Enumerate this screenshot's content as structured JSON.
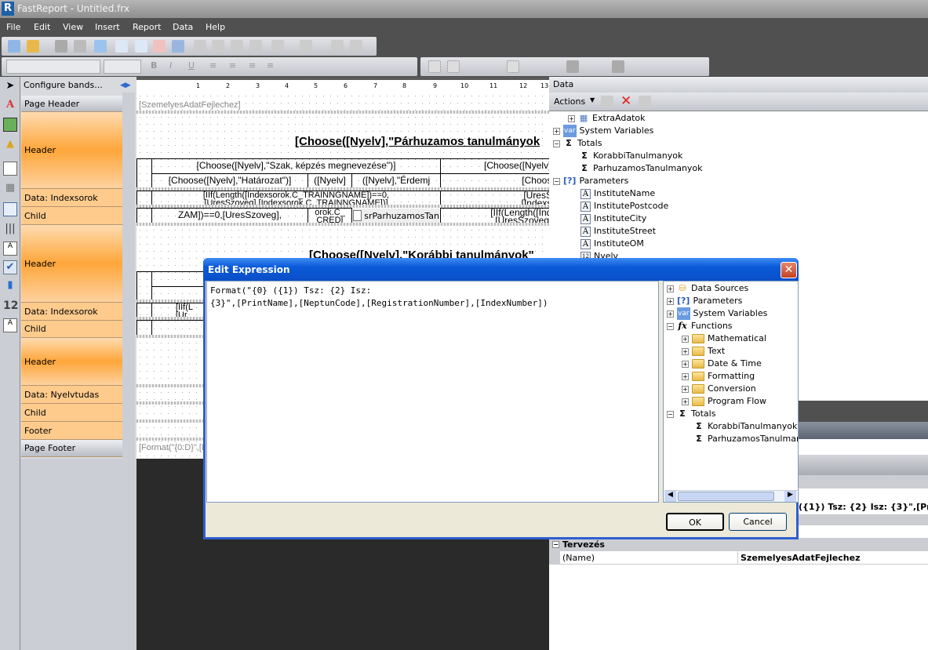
{
  "app": {
    "title": "FastReport - Untitled.frx",
    "logo": "R"
  },
  "menu": [
    "File",
    "Edit",
    "View",
    "Insert",
    "Report",
    "Data",
    "Help"
  ],
  "bands": {
    "configure": "Configure bands...",
    "items": [
      "Page Header",
      "Header",
      "Data: Indexsorok",
      "Child",
      "Header",
      "Data: Indexsorok",
      "Child",
      "Header",
      "Data: Nyelvtudas",
      "Child",
      "Footer",
      "Page Footer"
    ]
  },
  "ruler": [
    "1",
    "2",
    "3",
    "4",
    "5",
    "6",
    "7",
    "8",
    "9",
    "10",
    "11",
    "12",
    "13"
  ],
  "report": {
    "page_header_text": "[SzemelyesAdatFejlechez]",
    "title1": "[Choose([Nyelv],\"Párhuzamos tanulmányok",
    "h1": "[Choose([Nyelv],\"Szak, képzés megnevezése\")]",
    "h1b": "[Choose([Nyelv],\"",
    "h2a": "[Choose([Nyelv],\"Határozat\")]",
    "h2b": "([Nyelv]",
    "h2c": "([Nyelv],\"Érdemj",
    "h2d": "[Choose",
    "d1a": "[IIf(Length([Indexsorok.C_TRAINNGNAME])==0,",
    "d1b": "[UresSzoveg],[Indexsorok.C_TRAINNGNAME])]",
    "d1c": "[UresSz",
    "d1d": "[Indexso",
    "c1": "ZAM])==0,[UresSzoveg],",
    "c2": "orok.C_ CREDI",
    "subreport": "srParhuzamosTan",
    "c4": "[IIf(Length([Inde",
    "c4b": "[UresSzoveg],[",
    "title2": "[Choose([Nyelv],\"Korábbi tanulmányok\"",
    "h3": "[Ch",
    "h4": "[Choose",
    "d3a": "[IIf(L",
    "d3b": "[Ur",
    "c5": "ZAM])=",
    "footer_text": "[Format(\"{0:D}\",[D"
  },
  "data_panel": {
    "title": "Data",
    "actions": "Actions",
    "tree": [
      {
        "label": "ExtraAdatok",
        "icon": "table"
      },
      {
        "label": "System Variables",
        "icon": "var"
      },
      {
        "label": "Totals",
        "icon": "sigma"
      },
      {
        "label": "KorabbiTanulmanyok",
        "icon": "sigma"
      },
      {
        "label": "ParhuzamosTanulmanyok",
        "icon": "sigma"
      },
      {
        "label": "Parameters",
        "icon": "parameters"
      },
      {
        "label": "InstituteName",
        "icon": "text"
      },
      {
        "label": "InstitutePostcode",
        "icon": "text"
      },
      {
        "label": "InstituteCity",
        "icon": "text"
      },
      {
        "label": "InstituteStreet",
        "icon": "text"
      },
      {
        "label": "InstituteOM",
        "icon": "text"
      },
      {
        "label": "Nyelv",
        "icon": "number"
      }
    ]
  },
  "properties": {
    "value_preview": "({1}) Tsz: {2} Isz: {3}\",[Prin",
    "category": "Tervezés",
    "name_label": "(Name)",
    "name_value": "SzemelyesAdatFejlechez"
  },
  "dialog": {
    "title": "Edit Expression",
    "expression": "Format(\"{0} ({1}) Tsz: {2} Isz:\n{3}\",[PrintName],[NeptunCode],[RegistrationNumber],[IndexNumber])",
    "tree": [
      {
        "label": "Data Sources"
      },
      {
        "label": "Parameters"
      },
      {
        "label": "System Variables"
      },
      {
        "label": "Functions"
      },
      {
        "label": "Mathematical"
      },
      {
        "label": "Text"
      },
      {
        "label": "Date & Time"
      },
      {
        "label": "Formatting"
      },
      {
        "label": "Conversion"
      },
      {
        "label": "Program Flow"
      },
      {
        "label": "Totals"
      },
      {
        "label": "KorabbiTanulmanyok"
      },
      {
        "label": "ParhuzamosTanulmanyok"
      }
    ],
    "ok": "OK",
    "cancel": "Cancel"
  }
}
